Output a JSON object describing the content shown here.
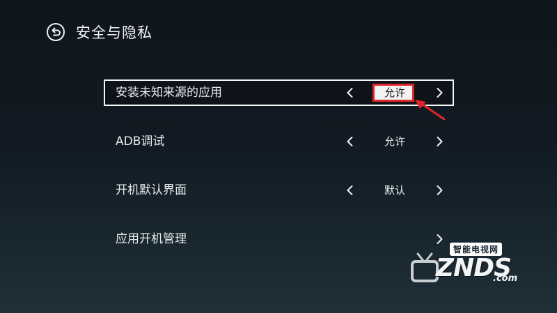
{
  "header": {
    "back_icon": "back-arrow-circle-icon",
    "title": "安全与隐私"
  },
  "settings": [
    {
      "label": "安装未知来源的应用",
      "value": "允许",
      "has_value": true,
      "focused": true,
      "highlighted": true
    },
    {
      "label": "ADB调试",
      "value": "允许",
      "has_value": true,
      "focused": false,
      "highlighted": false
    },
    {
      "label": "开机默认界面",
      "value": "默认",
      "has_value": true,
      "focused": false,
      "highlighted": false
    },
    {
      "label": "应用开机管理",
      "value": "",
      "has_value": false,
      "focused": false,
      "highlighted": false
    }
  ],
  "icons": {
    "prev": "chevron-left-icon",
    "next": "chevron-right-icon"
  },
  "annotation": {
    "highlight_color": "#e1262b",
    "arrow_icon": "red-pointer-arrow-icon"
  },
  "watermark": {
    "cn_text": "智能电视网",
    "brand": "ZNDS",
    "suffix": ".com"
  },
  "colors": {
    "background": "#111a22",
    "text": "#e9edf0",
    "focus_border": "#f4f6f8"
  }
}
